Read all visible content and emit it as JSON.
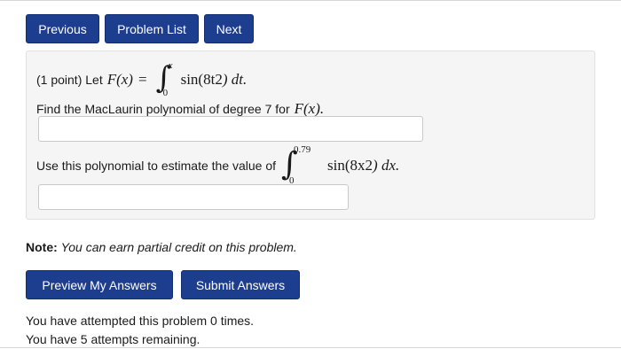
{
  "nav": {
    "previous": "Previous",
    "problem_list": "Problem List",
    "next": "Next"
  },
  "problem": {
    "points": "(1 point) Let",
    "function_name": "F(x)",
    "equals": "=",
    "integral_upper": "x",
    "integral_lower": "0",
    "integrand_sin": "sin(8t",
    "integrand_exp": "2",
    "integrand_rest": ") dt.",
    "question1_prefix": "Find the MacLaurin polynomial of degree 7 for",
    "question1_fn": "F(x).",
    "question2_prefix": "Use this polynomial to estimate the value of",
    "integral2_upper": "0.79",
    "integral2_lower": "0",
    "integrand2_sin": "sin(8x",
    "integrand2_exp": "2",
    "integrand2_rest": ") dx."
  },
  "answers": {
    "answer1_value": "",
    "answer2_value": ""
  },
  "note": {
    "label": "Note:",
    "text": "You can earn partial credit on this problem."
  },
  "actions": {
    "preview": "Preview My Answers",
    "submit": "Submit Answers"
  },
  "attempts": {
    "line1": "You have attempted this problem 0 times.",
    "line2": "You have 5 attempts remaining."
  },
  "colors": {
    "button_bg": "#1d3d8f",
    "panel_bg": "#f5f5f5"
  }
}
